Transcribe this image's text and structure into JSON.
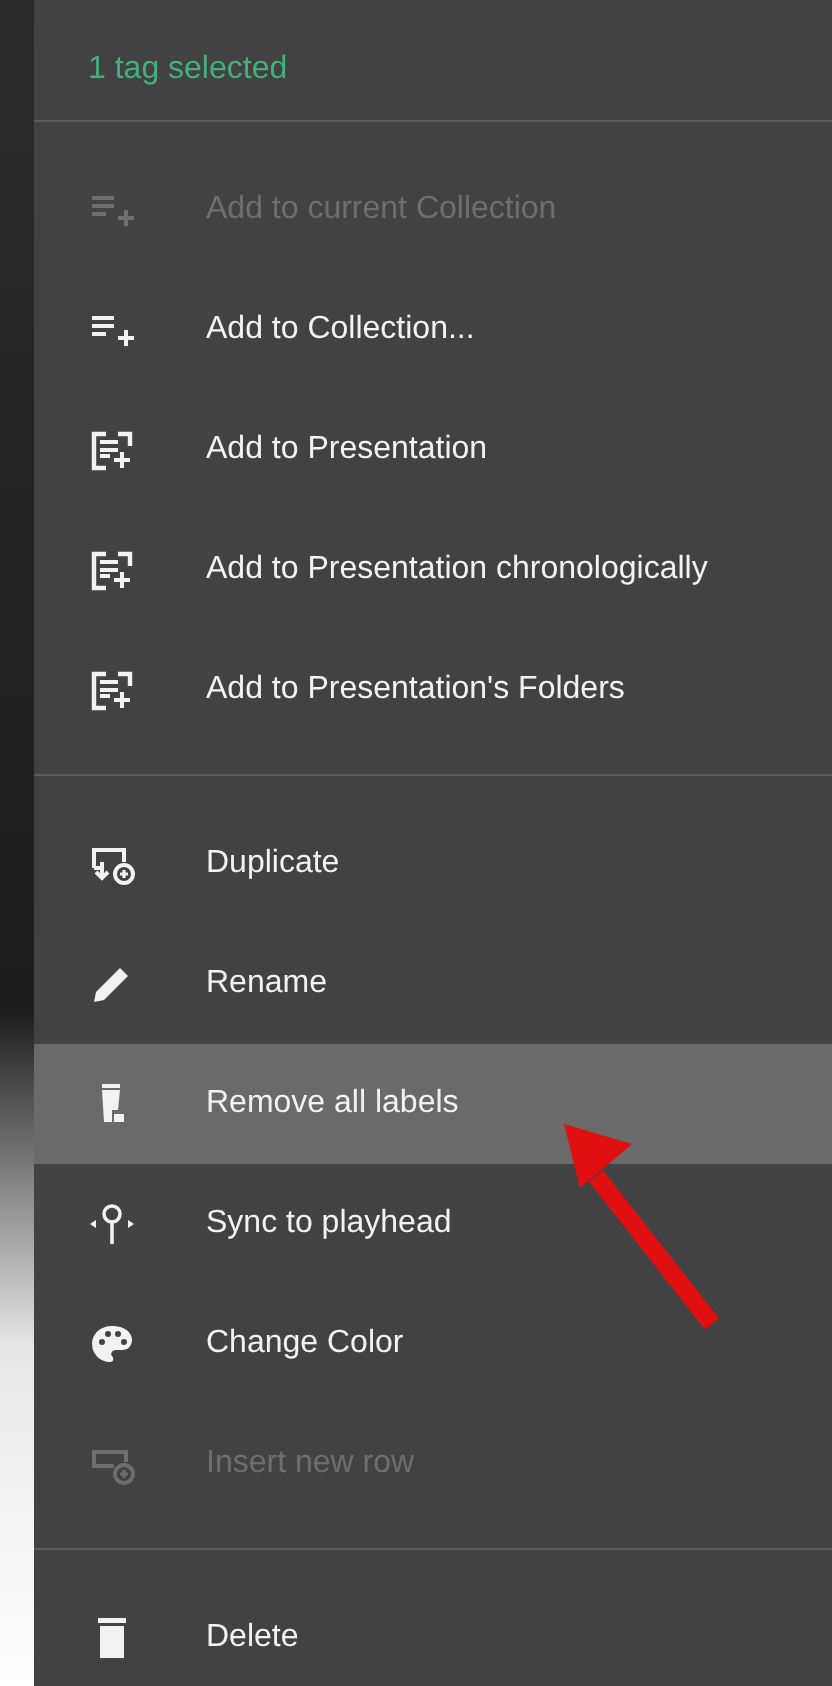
{
  "header": {
    "title": "1 tag selected"
  },
  "groups": [
    {
      "items": [
        {
          "label": "Add to current Collection",
          "kind": "list-add",
          "disabled": true,
          "selected": false
        },
        {
          "label": "Add to Collection...",
          "kind": "list-add",
          "disabled": false,
          "selected": false
        },
        {
          "label": "Add to Presentation",
          "kind": "slide-add",
          "disabled": false,
          "selected": false
        },
        {
          "label": "Add to Presentation chronologically",
          "kind": "slide-add",
          "disabled": false,
          "selected": false
        },
        {
          "label": "Add to Presentation's Folders",
          "kind": "slide-add",
          "disabled": false,
          "selected": false
        }
      ]
    },
    {
      "items": [
        {
          "label": "Duplicate",
          "kind": "duplicate",
          "disabled": false,
          "selected": false
        },
        {
          "label": "Rename",
          "kind": "pencil",
          "disabled": false,
          "selected": false
        },
        {
          "label": "Remove all labels",
          "kind": "remove-labels",
          "disabled": false,
          "selected": true
        },
        {
          "label": "Sync to playhead",
          "kind": "playhead",
          "disabled": false,
          "selected": false
        },
        {
          "label": "Change Color",
          "kind": "palette",
          "disabled": false,
          "selected": false
        },
        {
          "label": "Insert new row",
          "kind": "row-add",
          "disabled": true,
          "selected": false
        }
      ]
    },
    {
      "items": [
        {
          "label": "Delete",
          "kind": "trash",
          "disabled": false,
          "selected": false
        }
      ]
    }
  ],
  "annotation": {
    "kind": "arrow",
    "color": "#e01010"
  }
}
